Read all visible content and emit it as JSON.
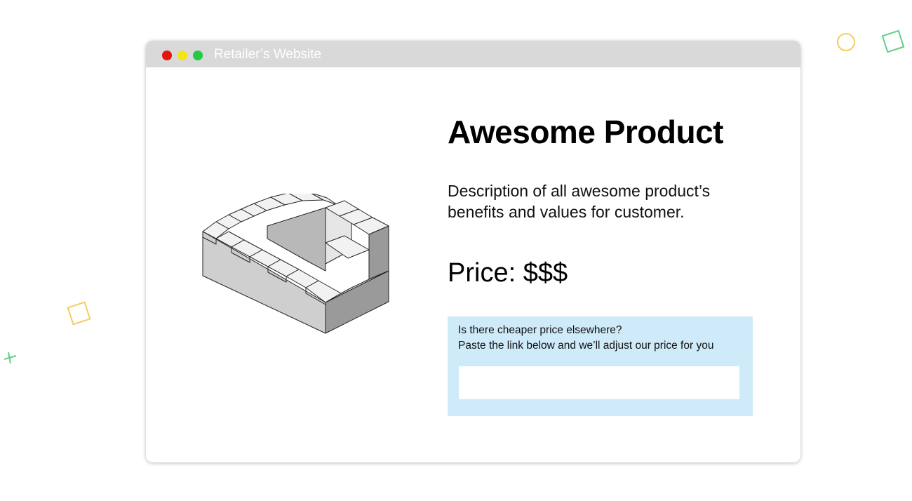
{
  "window": {
    "title": "Retailer’s Website",
    "controls": [
      {
        "name": "close",
        "color": "#e3160b"
      },
      {
        "name": "minimize",
        "color": "#f2e511"
      },
      {
        "name": "maximize",
        "color": "#23c845"
      }
    ]
  },
  "product": {
    "image_icon": "impossible-staircase-illustration",
    "title": "Awesome Product",
    "description": "Description of all awesome product’s benefits and values for customer.",
    "price": "Price: $$$"
  },
  "price_match": {
    "line1": "Is there cheaper price elsewhere?",
    "line2": "Paste the link below and we’ll adjust our price for you",
    "input_value": "",
    "input_placeholder": ""
  },
  "decorations": {
    "icons": [
      "circle-outline-icon",
      "diamond-outline-icon",
      "diamond-outline-icon",
      "plus-icon"
    ],
    "colors": {
      "yellow": "#f5cd58",
      "green": "#5fcf86"
    }
  }
}
